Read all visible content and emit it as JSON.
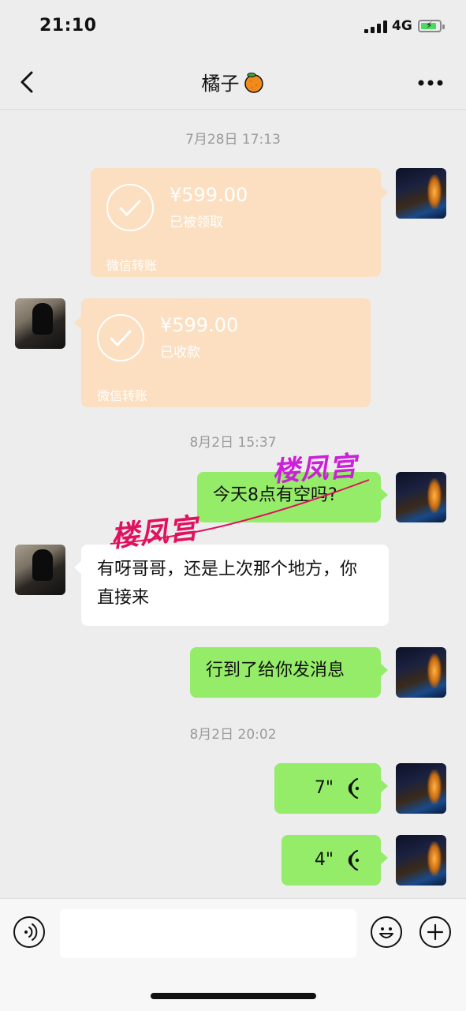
{
  "status_bar": {
    "time": "21:10",
    "network": "4G"
  },
  "header": {
    "title": "橘子",
    "title_emoji": "🍊"
  },
  "messages": {
    "ts1": "7月28日 17:13",
    "transfer1": {
      "amount": "¥599.00",
      "status": "已被领取",
      "label": "微信转账"
    },
    "transfer2": {
      "amount": "¥599.00",
      "status": "已收款",
      "label": "微信转账"
    },
    "ts2": "8月2日 15:37",
    "msg1": "今天8点有空吗?",
    "msg2": "有呀哥哥，还是上次那个地方，你直接来",
    "msg3": "行到了给你发消息",
    "ts3": "8月2日 20:02",
    "voice1": "7\"",
    "voice2": "4\""
  },
  "watermark": {
    "text": "楼凤宫"
  },
  "colors": {
    "background": "#ededed",
    "self_bubble": "#95ec69",
    "peer_bubble": "#ffffff",
    "transfer_card": "#fbdfc0",
    "watermark_red": "#e0115f",
    "watermark_purple": "#cc1fd8"
  },
  "icons": [
    "back-icon",
    "more-icon",
    "voice-mode-icon",
    "emoji-icon",
    "plus-icon",
    "checkmark-icon",
    "voice-wave-icon"
  ]
}
